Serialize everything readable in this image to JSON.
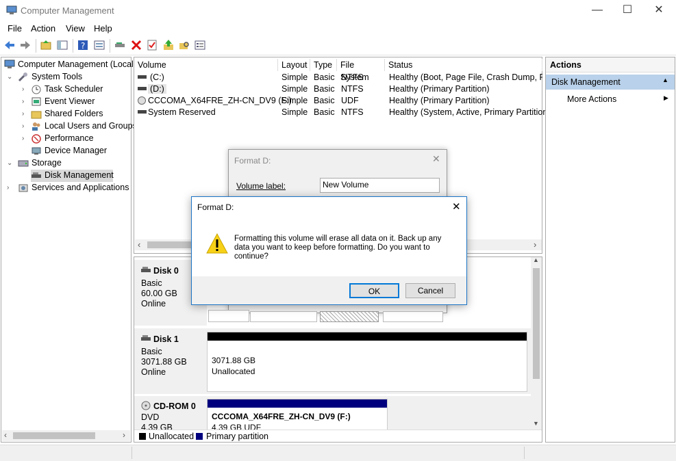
{
  "window": {
    "title": "Computer Management",
    "minimize": "—",
    "maximize": "☐",
    "close": "✕"
  },
  "menu": [
    "File",
    "Action",
    "View",
    "Help"
  ],
  "tree": {
    "root": "Computer Management (Local",
    "system_tools": "System Tools",
    "task_scheduler": "Task Scheduler",
    "event_viewer": "Event Viewer",
    "shared_folders": "Shared Folders",
    "local_users": "Local Users and Groups",
    "performance": "Performance",
    "device_manager": "Device Manager",
    "storage": "Storage",
    "disk_management": "Disk Management",
    "services": "Services and Applications"
  },
  "volumes": {
    "headers": [
      "Volume",
      "Layout",
      "Type",
      "File System",
      "Status"
    ],
    "rows": [
      [
        "(C:)",
        "Simple",
        "Basic",
        "NTFS",
        "Healthy (Boot, Page File, Crash Dump, Prir"
      ],
      [
        "(D:)",
        "Simple",
        "Basic",
        "NTFS",
        "Healthy (Primary Partition)"
      ],
      [
        "CCCOMA_X64FRE_ZH-CN_DV9 (F:)",
        "Simple",
        "Basic",
        "UDF",
        "Healthy (Primary Partition)"
      ],
      [
        "System Reserved",
        "Simple",
        "Basic",
        "NTFS",
        "Healthy (System, Active, Primary Partition)"
      ]
    ]
  },
  "disks": {
    "disk0": {
      "name": "Disk 0",
      "type": "Basic",
      "size": "60.00 GB",
      "state": "Online"
    },
    "disk1": {
      "name": "Disk 1",
      "type": "Basic",
      "size": "3071.88 GB",
      "state": "Online",
      "part_size": "3071.88 GB",
      "part_state": "Unallocated"
    },
    "cdrom0": {
      "name": "CD-ROM 0",
      "type": "DVD",
      "size": "4.39 GB",
      "part_name": "CCCOMA_X64FRE_ZH-CN_DV9  (F:)",
      "part_size": "4.39 GB UDF"
    }
  },
  "legend": {
    "unallocated": "Unallocated",
    "primary": "Primary partition"
  },
  "actions": {
    "header": "Actions",
    "section": "Disk Management",
    "more": "More Actions"
  },
  "format_dialog": {
    "title": "Format D:",
    "volume_label_caption": "Volume label:",
    "volume_label_value": "New Volume"
  },
  "confirm_dialog": {
    "title": "Format D:",
    "message": "Formatting this volume will erase all data on it. Back up any data you want to keep before formatting. Do you want to continue?",
    "ok": "OK",
    "cancel": "Cancel"
  },
  "colors": {
    "primary_partition": "#00007f",
    "unallocated": "#000000",
    "selection": "#cce8ff",
    "actions_section": "#b9d1ea"
  }
}
